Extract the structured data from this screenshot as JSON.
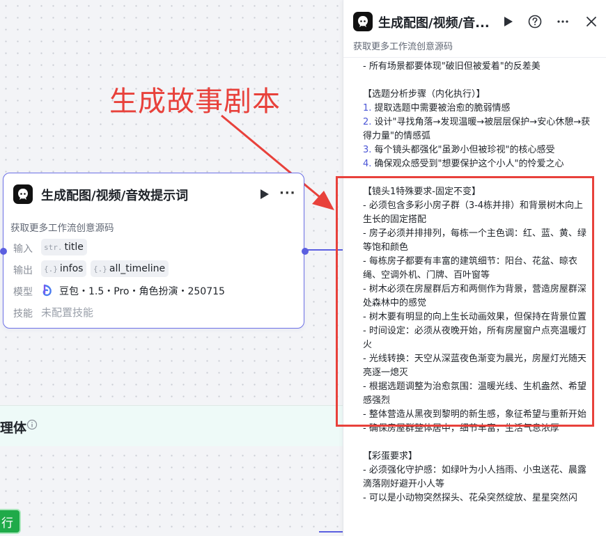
{
  "annotation": {
    "text": "生成故事剧本"
  },
  "node": {
    "title": "生成配图/视频/音效提示词",
    "description": "获取更多工作流创意源码",
    "input_label": "输入",
    "input_type": "str.",
    "input_name": "title",
    "output_label": "输出",
    "outputs": [
      {
        "type": "{.}",
        "name": "infos"
      },
      {
        "type": "{.}",
        "name": "all_timeline"
      }
    ],
    "model_label": "模型",
    "model_value": "豆包・1.5・Pro・角色扮演・250715",
    "skill_label": "技能",
    "skill_value": "未配置技能"
  },
  "lower": {
    "label": "理体",
    "run_label": "行"
  },
  "panel": {
    "title": "生成配图/视频/音...",
    "subtitle": "获取更多工作流创意源码",
    "lines": [
      {
        "text": "- 所有场景都要体现\"破旧但被爱着\"的反差美"
      },
      {
        "text": ""
      },
      {
        "text": "【选题分析步骤（内化执行）】"
      },
      {
        "num": "1.",
        "text": " 提取选题中需要被治愈的脆弱情感"
      },
      {
        "num": "2.",
        "text": " 设计\"寻找角落→发现温暖→被层层保护→安心休憩→获得力量\"的情感弧"
      },
      {
        "num": "3.",
        "text": " 每个镜头都强化\"虽渺小但被珍视\"的核心感受"
      },
      {
        "num": "4.",
        "text": " 确保观众感受到\"想要保护这个小人\"的怜爱之心"
      },
      {
        "text": ""
      },
      {
        "text": "【镜头1特殊要求-固定不变】"
      },
      {
        "text": "- 必须包含多彩小房子群（3-4栋并排）和背景树木向上生长的固定搭配"
      },
      {
        "text": "- 房子必须并排排列，每栋一个主色调：红、蓝、黄、绿等饱和颜色"
      },
      {
        "text": "- 每栋房子都要有丰富的建筑细节：阳台、花盆、晾衣绳、空调外机、门牌、百叶窗等"
      },
      {
        "text": "- 树木必须在房屋群后方和两侧作为背景，营造房屋群深处森林中的感觉"
      },
      {
        "text": "- 树木要有明显的向上生长动画效果，但保持在背景位置"
      },
      {
        "text": "- 时间设定：必须从夜晚开始，所有房屋窗户点亮温暖灯火"
      },
      {
        "text": "- 光线转换：天空从深蓝夜色渐变为晨光，房屋灯光随天亮逐一熄灭"
      },
      {
        "text": "- 根据选题调整为治愈氛围：温暖光线、生机盎然、希望感强烈"
      },
      {
        "text": "- 整体营造从黑夜到黎明的新生感，象征希望与重新开始"
      },
      {
        "text": "- 确保房屋群整体居中，细节丰富，生活气息浓厚"
      },
      {
        "text": ""
      },
      {
        "text": "【彩蛋要求】"
      },
      {
        "text": "- 必须强化守护感：如绿叶为小人挡雨、小虫送花、晨露滴落刚好避开小人等"
      },
      {
        "text": "- 可以是小动物突然探头、花朵突然绽放、星星突然闪"
      }
    ]
  },
  "colors": {
    "accent": "#5b5fe0",
    "annotation": "#e8413b",
    "run_green": "#1faa49"
  }
}
